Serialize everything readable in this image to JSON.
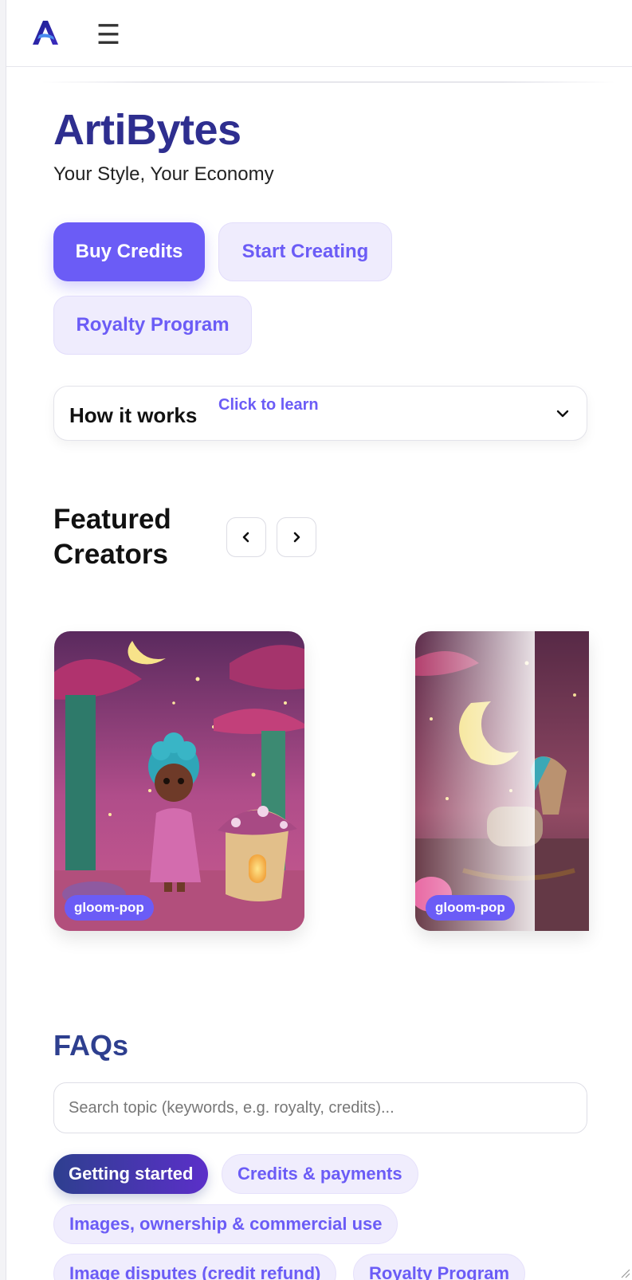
{
  "header": {
    "logo_icon": "artibytes-a-logo",
    "menu_glyph": "☰"
  },
  "hero": {
    "title": "ArtiBytes",
    "tagline": "Your Style, Your Economy",
    "buttons": {
      "buy": "Buy Credits",
      "start": "Start Creating",
      "royalty": "Royalty Program"
    }
  },
  "how_it_works": {
    "title": "How it works",
    "hint": "Click to learn"
  },
  "featured": {
    "title": "Featured Creators",
    "cards": [
      {
        "creator": "gloom-pop"
      },
      {
        "creator": "gloom-pop"
      }
    ]
  },
  "faq": {
    "title": "FAQs",
    "search_placeholder": "Search topic (keywords, e.g. royalty, credits)...",
    "chips": [
      "Getting started",
      "Credits & payments",
      "Images, ownership & commercial use",
      "Image disputes (credit refund)",
      "Royalty Program"
    ]
  },
  "colors": {
    "accent": "#6b5cf6",
    "brand_navy": "#2e2e8f",
    "faq_navy": "#2e3f8f"
  }
}
